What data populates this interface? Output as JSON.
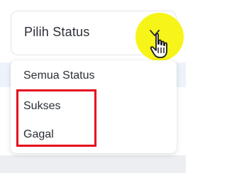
{
  "select": {
    "label": "Pilih Status"
  },
  "dropdown": {
    "options": [
      {
        "label": "Semua Status"
      },
      {
        "label": "Sukses"
      },
      {
        "label": "Gagal"
      }
    ]
  },
  "icons": {
    "chevron": "chevron-down-icon",
    "cursor": "hand-pointer-cursor-icon"
  },
  "colors": {
    "highlight": "#f6f418",
    "annotation_border": "#e5091d",
    "text": "#2b2f36",
    "band": "#eef3fb"
  }
}
